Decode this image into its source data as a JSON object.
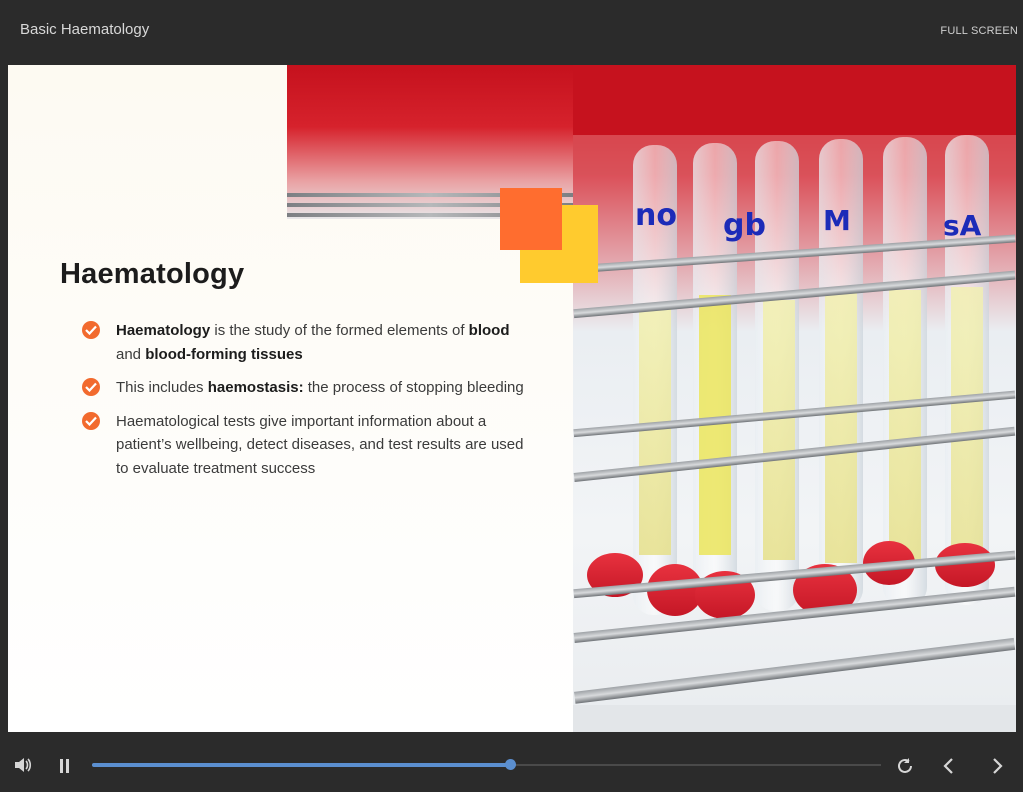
{
  "header": {
    "course_title": "Basic Haematology",
    "fullscreen_label": "FULL SCREEN"
  },
  "slide": {
    "heading": "Haematology",
    "bullets": [
      {
        "parts": [
          {
            "b": "Haematology"
          },
          {
            "t": " is the study of the formed elements of "
          },
          {
            "b": "blood"
          },
          {
            "t": " and "
          },
          {
            "b": "blood-forming tissues"
          }
        ]
      },
      {
        "parts": [
          {
            "t": "This includes "
          },
          {
            "b": "haemostasis:"
          },
          {
            "t": " the process of stopping bleeding"
          }
        ]
      },
      {
        "parts": [
          {
            "t": "Haematological tests give important information about a patient’s wellbeing, detect diseases, and test results are used to evaluate treatment success"
          }
        ]
      }
    ],
    "accent_colors": {
      "orange": "#ff6d2f",
      "yellow": "#ffcb2e",
      "check": "#f26a2e"
    },
    "photo_icon": "test-tubes-photo"
  },
  "player": {
    "progress": 0.53,
    "progress_color": "#5b8fd0",
    "icons": [
      "volume-icon",
      "pause-icon",
      "replay-icon",
      "chevron-left-icon",
      "chevron-right-icon"
    ]
  }
}
